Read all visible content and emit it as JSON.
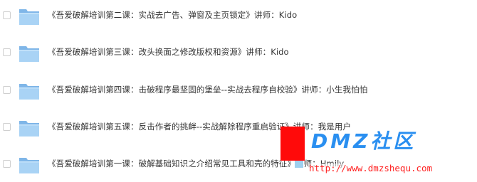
{
  "folders": [
    {
      "name": "《吾爱破解培训第二课：实战去广告、弹窗及主页锁定》讲师：Kido",
      "icon": "folder-icon"
    },
    {
      "name": "《吾爱破解培训第三课：改头换面之修改版权和资源》讲师：Kido",
      "icon": "folder-icon"
    },
    {
      "name": "《吾爱破解培训第四课：击破程序最坚固的堡垒--实战去程序自校验》讲师：小生我怕怕",
      "icon": "folder-icon"
    },
    {
      "name": "《吾爱破解培训第五课：反击作者的挑衅--实战解除程序重启验证》讲师：我是用户",
      "icon": "folder-icon"
    },
    {
      "name": "《吾爱破解培训第一课：破解基础知识之介绍常见工具和壳的特征》讲师：Hmily",
      "icon": "folder-icon"
    }
  ],
  "watermark": {
    "logo_text": "DMZ社区",
    "url": "http://www.dmzshequ.com",
    "colors": {
      "logo": "#2a8ff0",
      "url": "#ff1f1f",
      "square": "#ff0a0a"
    }
  },
  "colors": {
    "folder_body": "#7fb6e8",
    "folder_front": "#a9d3f5",
    "text": "#333333",
    "checkbox_border": "#cfcfcf"
  }
}
